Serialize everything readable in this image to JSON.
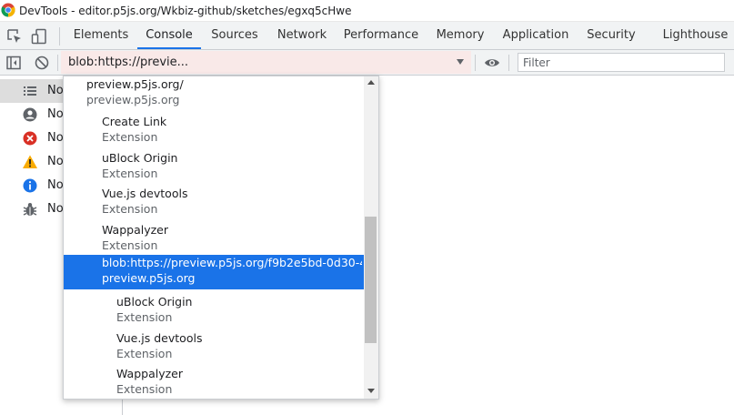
{
  "window": {
    "title": "DevTools - editor.p5js.org/Wkbiz-github/sketches/egxq5cHwe"
  },
  "tabs": [
    {
      "label": "Elements"
    },
    {
      "label": "Console"
    },
    {
      "label": "Sources"
    },
    {
      "label": "Network"
    },
    {
      "label": "Performance"
    },
    {
      "label": "Memory"
    },
    {
      "label": "Application"
    },
    {
      "label": "Security"
    },
    {
      "label": "Lighthouse"
    }
  ],
  "active_tab": "Console",
  "toolbar": {
    "context_value": "blob:https://previe...",
    "filter_placeholder": "Filter"
  },
  "sidebar": {
    "items": [
      {
        "label": "No",
        "icon": "list-icon"
      },
      {
        "label": "No",
        "icon": "user-icon"
      },
      {
        "label": "No",
        "icon": "error-icon"
      },
      {
        "label": "No",
        "icon": "warning-icon"
      },
      {
        "label": "No",
        "icon": "info-icon"
      },
      {
        "label": "No",
        "icon": "bug-icon"
      }
    ]
  },
  "dropdown": {
    "items": [
      {
        "title": "preview.p5js.org/",
        "subtitle": "preview.p5js.org"
      },
      {
        "title": "Create Link",
        "subtitle": "Extension"
      },
      {
        "title": "uBlock Origin",
        "subtitle": "Extension"
      },
      {
        "title": "Vue.js devtools",
        "subtitle": "Extension"
      },
      {
        "title": "Wappalyzer",
        "subtitle": "Extension"
      },
      {
        "title": "blob:https://preview.p5js.org/f9b2e5bd-0d30-4...",
        "subtitle": "preview.p5js.org"
      },
      {
        "title": "uBlock Origin",
        "subtitle": "Extension"
      },
      {
        "title": "Vue.js devtools",
        "subtitle": "Extension"
      },
      {
        "title": "Wappalyzer",
        "subtitle": "Extension"
      }
    ]
  },
  "colors": {
    "accent": "#1a73e8",
    "error": "#d93025",
    "warning": "#f9ab00",
    "info": "#1a73e8",
    "context_bg": "#f9e9e8"
  }
}
